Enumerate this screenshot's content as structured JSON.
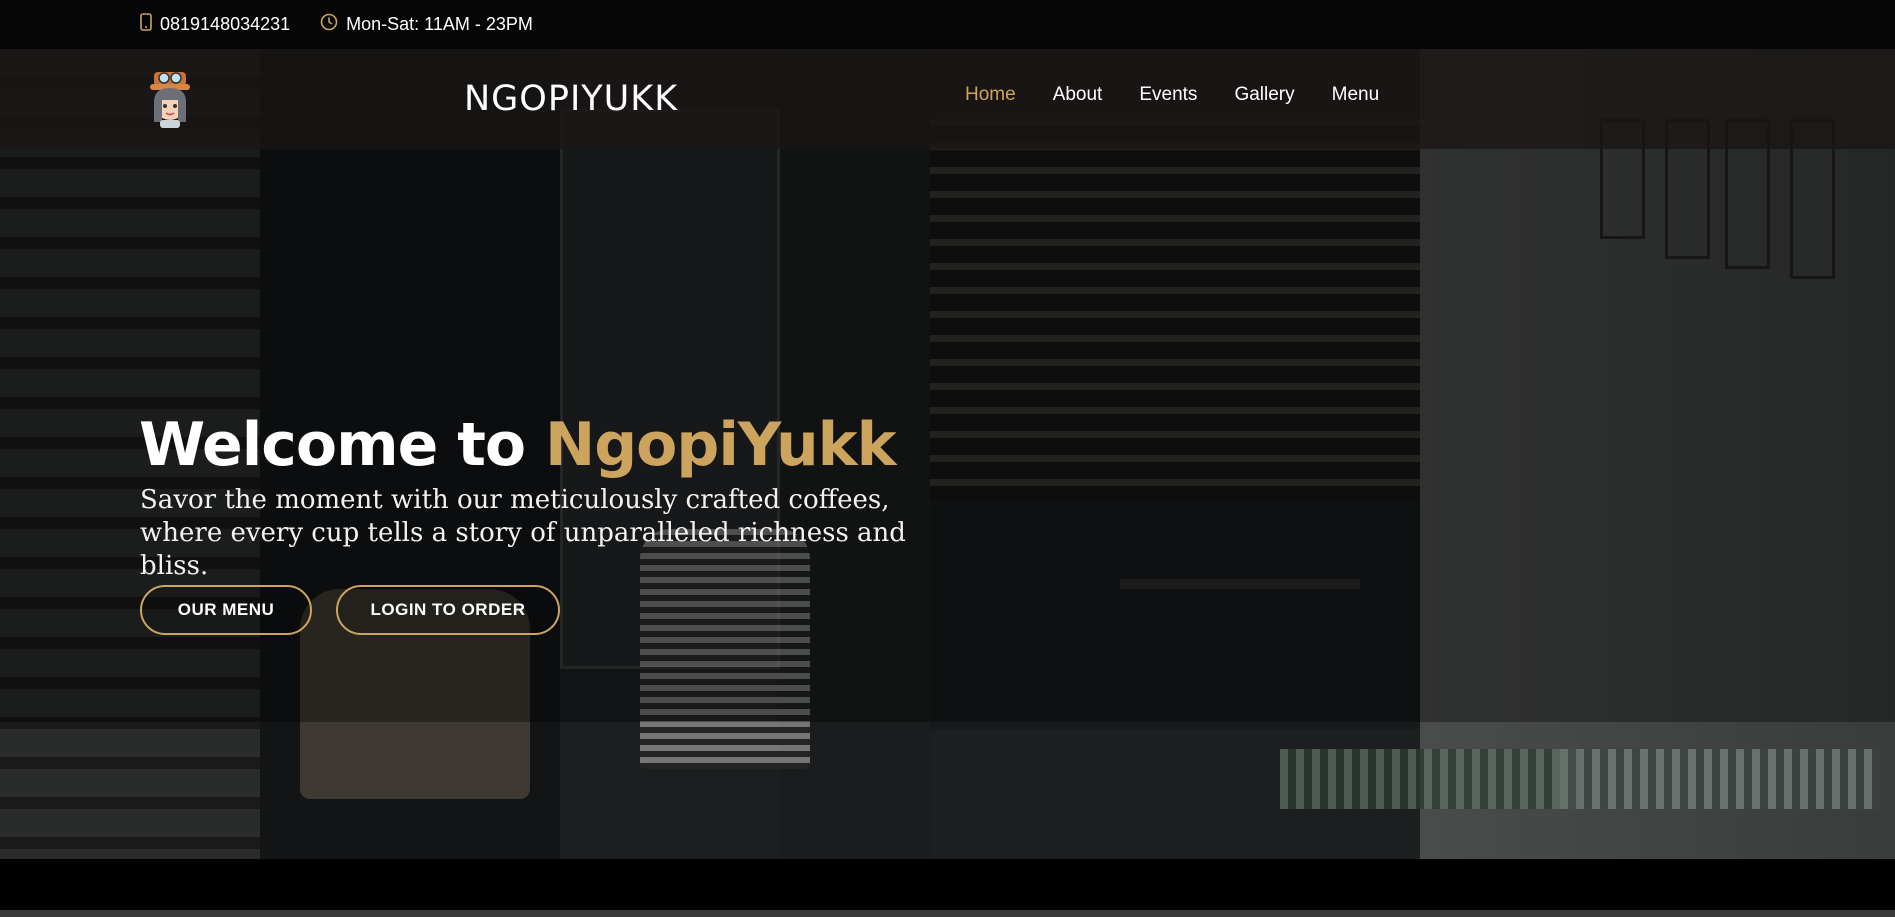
{
  "topbar": {
    "phone": "0819148034231",
    "hours": "Mon-Sat: 11AM - 23PM",
    "phone_icon": "phone-icon",
    "clock_icon": "clock-icon",
    "icon_color": "#cda45e"
  },
  "header": {
    "brand": "NGOPIYUKK",
    "logo_icon": "mascot-logo-icon",
    "nav": [
      {
        "label": "Home",
        "active": true
      },
      {
        "label": "About",
        "active": false
      },
      {
        "label": "Events",
        "active": false
      },
      {
        "label": "Gallery",
        "active": false
      },
      {
        "label": "Menu",
        "active": false
      }
    ]
  },
  "hero": {
    "title_prefix": "Welcome to ",
    "title_accent": "NgopiYukk",
    "subtitle_line1": "Savor the moment with our meticulously crafted coffees,",
    "subtitle_line2": "where every cup tells a story of unparalleled richness and bliss.",
    "buttons": {
      "menu": "OUR MENU",
      "login": "LOGIN TO ORDER"
    }
  },
  "colors": {
    "accent": "#cda45e",
    "background": "#000000",
    "navbar": "#191614"
  }
}
